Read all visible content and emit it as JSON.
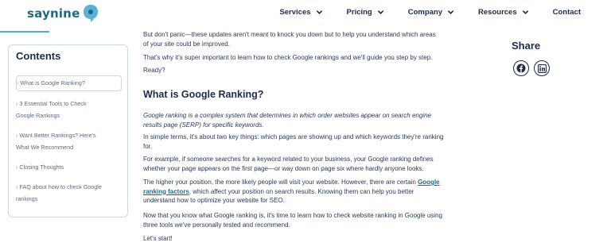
{
  "header": {
    "logo_text": "saynine",
    "nav": [
      {
        "label": "Services",
        "has_dropdown": true
      },
      {
        "label": "Pricing",
        "has_dropdown": true
      },
      {
        "label": "Company",
        "has_dropdown": true
      },
      {
        "label": "Resources",
        "has_dropdown": true
      },
      {
        "label": "Contact",
        "has_dropdown": false
      }
    ],
    "colors": {
      "brand": "#1a6a86",
      "accent": "#54a9cd",
      "text": "#1d2b4f"
    }
  },
  "toc": {
    "title": "Contents",
    "items": [
      "What is Google Ranking?",
      "3 Essential Tools to Check",
      "Google Rankings",
      "Want Better Rankings? Here's",
      "What We Recommend",
      "Closing Thoughts",
      "FAQ about how to check Google",
      "rankings"
    ]
  },
  "article": {
    "p1": "But don't panic—these updates aren't meant to knock you down but to help you understand which areas",
    "p1b": "of your site could be improved.",
    "p2": "That's why it's super important to learn how to check Google rankings and we'll guide you step by step.",
    "p3": "Ready?",
    "h2": "What is Google Ranking?",
    "def1": "Google ranking is a complex system that determines in which order websites appear on search engine",
    "def2": "results page (SERP) for specific keywords.",
    "s1": "In simple terms, it's about two key things: which pages are showing up and which keywords they're ranking",
    "s1b": "for.",
    "e1": "For example, if someone searches for a keyword related to your business, your Google ranking defines",
    "e2": "whether your page appears on the first page—or way down on page six where hardly anyone looks.",
    "h1": "The higher your position, the more likely people will visit your website. However, there are certain",
    "h1_link": "Google",
    "h2_link": "ranking factors",
    "h2_rest": ", which affect your position on search results. Knowing them can help you better",
    "h3": "understand how to optimize your website for SEO.",
    "n1": "Now that you know what Google ranking is, it's time to learn how to check website ranking in Google using",
    "n2": "three tools we've personally tested and recommend.",
    "start": "Let's start!"
  },
  "share": {
    "title": "Share",
    "buttons": [
      "facebook-icon",
      "linkedin-icon"
    ]
  }
}
